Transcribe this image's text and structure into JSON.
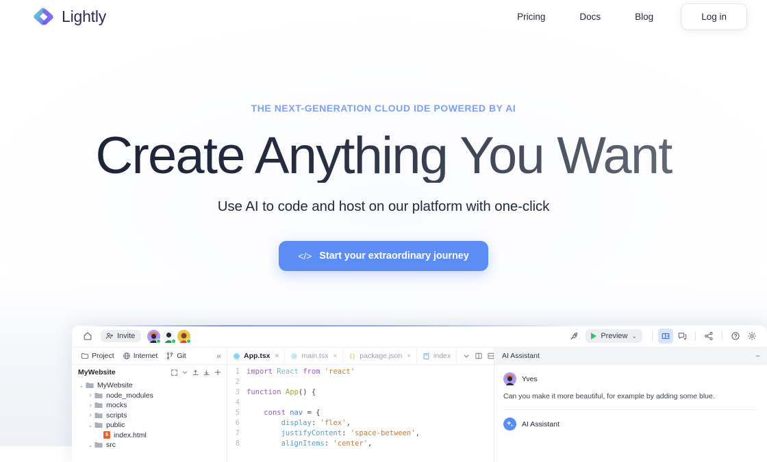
{
  "brand": {
    "name": "Lightly",
    "logo_icon": "code-brackets-logo",
    "accent_teal": "#4ed8d0",
    "accent_purple": "#7c6cf0"
  },
  "nav": {
    "links": [
      {
        "label": "Pricing",
        "name": "nav-link-pricing"
      },
      {
        "label": "Docs",
        "name": "nav-link-docs"
      },
      {
        "label": "Blog",
        "name": "nav-link-blog"
      }
    ],
    "login_label": "Log in"
  },
  "hero": {
    "eyebrow": "THE NEXT-GENERATION CLOUD IDE POWERED BY AI",
    "eyebrow_color": "#7ca1f2",
    "headline": "Create Anything You Want",
    "subhead": "Use AI to code and host on our platform with one-click",
    "cta_icon": "</>",
    "cta_label": "Start your extraordinary journey",
    "cta_color": "#5b8df5"
  },
  "ide": {
    "toolbar": {
      "home_icon": "home-icon",
      "invite_label": "Invite",
      "invite_icon": "person-add-icon",
      "avatars": [
        {
          "name": "collaborator-avatar-1",
          "bg": "#b39af0",
          "status": "online"
        },
        {
          "name": "collaborator-avatar-2",
          "bg": "#f2f4f7",
          "status": "online"
        },
        {
          "name": "collaborator-avatar-3",
          "bg": "#f0c34d",
          "status": "online"
        }
      ],
      "rocket_icon": "rocket-icon",
      "preview_label": "Preview",
      "preview_chevron": "⌄",
      "layout_icon": "split-layout-icon",
      "chat_icon": "chat-bubble-icon",
      "share_icon": "share-icon",
      "help_icon": "help-circle-icon",
      "settings_icon": "gear-icon"
    },
    "sidebar": {
      "tabs": [
        {
          "label": "Project",
          "icon": "folder-icon"
        },
        {
          "label": "Internet",
          "icon": "globe-icon"
        },
        {
          "label": "Git",
          "icon": "git-branch-icon"
        }
      ],
      "collapse_icon": "«",
      "project_name": "MyWebsite",
      "actions": [
        "collapse-all-icon",
        "chevron-down-icon",
        "upload-icon",
        "download-icon",
        "plus-icon"
      ],
      "tree": [
        {
          "label": "MyWebsite",
          "depth": 0,
          "type": "folder",
          "expanded": true
        },
        {
          "label": "node_modules",
          "depth": 1,
          "type": "folder",
          "expanded": false
        },
        {
          "label": "mocks",
          "depth": 1,
          "type": "folder",
          "expanded": false
        },
        {
          "label": "scripts",
          "depth": 1,
          "type": "folder",
          "expanded": false
        },
        {
          "label": "public",
          "depth": 1,
          "type": "folder",
          "expanded": true
        },
        {
          "label": "index.html",
          "depth": 2,
          "type": "html",
          "expanded": null
        },
        {
          "label": "src",
          "depth": 1,
          "type": "folder",
          "expanded": true
        }
      ]
    },
    "editor": {
      "tabs": [
        {
          "label": "App.tsx",
          "icon": "react-icon",
          "active": true,
          "close": "×"
        },
        {
          "label": "main.tsx",
          "icon": "react-icon",
          "active": false,
          "close": "×"
        },
        {
          "label": "package.json",
          "icon": "braces-icon",
          "active": false,
          "close": "×"
        },
        {
          "label": "index",
          "icon": "file-icon",
          "active": false,
          "close": ""
        }
      ],
      "controls": [
        "chevron-down-icon",
        "split-vertical-icon",
        "split-horizontal-icon",
        "more-icon"
      ],
      "lines": [
        {
          "no": "1",
          "tokens": [
            {
              "t": "import ",
              "c": "k"
            },
            {
              "t": "React",
              "c": "c-cls"
            },
            {
              "t": " from ",
              "c": "k"
            },
            {
              "t": "'react'",
              "c": "c-str"
            }
          ]
        },
        {
          "no": "2",
          "tokens": []
        },
        {
          "no": "3",
          "tokens": [
            {
              "t": "function ",
              "c": "k"
            },
            {
              "t": "App",
              "c": "c-fn"
            },
            {
              "t": "() {",
              "c": "c-pln"
            }
          ]
        },
        {
          "no": "4",
          "tokens": []
        },
        {
          "no": "5",
          "tokens": [
            {
              "t": "    ",
              "c": "c-pln"
            },
            {
              "t": "const ",
              "c": "k"
            },
            {
              "t": "nav",
              "c": "c-var"
            },
            {
              "t": " = {",
              "c": "c-pln"
            }
          ]
        },
        {
          "no": "6",
          "tokens": [
            {
              "t": "        ",
              "c": "c-pln"
            },
            {
              "t": "display",
              "c": "c-prop"
            },
            {
              "t": ": ",
              "c": "c-pln"
            },
            {
              "t": "'flex'",
              "c": "c-str"
            },
            {
              "t": ",",
              "c": "c-pln"
            }
          ]
        },
        {
          "no": "7",
          "tokens": [
            {
              "t": "        ",
              "c": "c-pln"
            },
            {
              "t": "justifyContent",
              "c": "c-prop"
            },
            {
              "t": ": ",
              "c": "c-pln"
            },
            {
              "t": "'space-between'",
              "c": "c-str"
            },
            {
              "t": ",",
              "c": "c-pln"
            }
          ]
        },
        {
          "no": "8",
          "tokens": [
            {
              "t": "        ",
              "c": "c-pln"
            },
            {
              "t": "alignItems",
              "c": "c-prop"
            },
            {
              "t": ": ",
              "c": "c-pln"
            },
            {
              "t": "'center'",
              "c": "c-str"
            },
            {
              "t": ",",
              "c": "c-pln"
            }
          ]
        }
      ]
    },
    "ai": {
      "title": "AI Assistant",
      "minimize_icon": "−",
      "messages": [
        {
          "author": "Yves",
          "avatar": "user-avatar",
          "avatar_bg": "#b39af0",
          "text": "Can you make it more beautiful, for example by adding some blue."
        },
        {
          "author": "AI Assistant",
          "avatar": "sparkle-icon",
          "avatar_bg": "#5b8df5",
          "text": ""
        }
      ]
    }
  }
}
